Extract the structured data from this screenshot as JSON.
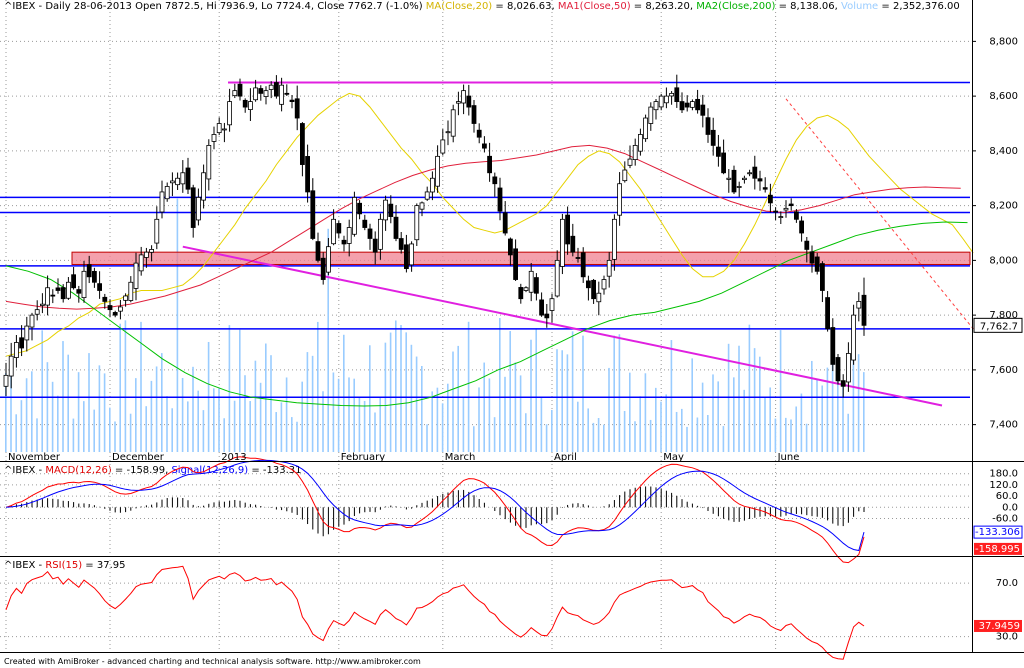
{
  "header": {
    "price": {
      "symbol": "^IBEX",
      "info": " - Daily 28-06-2013 Open 7872.5, Hi 7936.9, Lo 7724.4, Close 7762.7 (-1.0%) ",
      "ma20_label": "MA(Close,20)",
      "ma20_value": " = 8,026.63, ",
      "ma50_label": "MA1(Close,50)",
      "ma50_value": " = 8,263.20, ",
      "ma200_label": "MA2(Close,200)",
      "ma200_value": " = 8,138.06, ",
      "vol_label": "Volume",
      "vol_value": " = 2,352,376.00"
    },
    "macd": {
      "symbol": "^IBEX",
      "sep": " - ",
      "macd_label": "MACD(12,26)",
      "macd_value": " = -158.99, ",
      "signal_label": "Signal(12,26,9)",
      "signal_value": " = -133.31"
    },
    "rsi": {
      "symbol": "^IBEX",
      "sep": " - ",
      "rsi_label": "RSI(15)",
      "rsi_value": " = 37.95"
    }
  },
  "footer": "Created with AmiBroker - advanced charting and technical analysis software. http://www.amibroker.com",
  "colors": {
    "up_bar": "#ffffff",
    "down_bar": "#000000",
    "ma20": "#e6d200",
    "ma50": "#e0203c",
    "ma200": "#00c000",
    "volume": "#99ccff",
    "support": "#0000ff",
    "trend": "#e020e0",
    "resistance_band": "#f08090",
    "macd": "#ff0000",
    "signal": "#0000ff",
    "rsi": "#ff0000"
  },
  "chart_data": [
    {
      "type": "candlestick",
      "title": "^IBEX - Daily 28-06-2013",
      "ohlc_last": {
        "open": 7872.5,
        "high": 7936.9,
        "low": 7724.4,
        "close": 7762.7,
        "change": "-1.0%"
      },
      "ylim": [
        7300,
        8900
      ],
      "yticks": [
        7400,
        7600,
        7800,
        8000,
        8200,
        8400,
        8600,
        8800
      ],
      "ytick_labels": [
        "7,400",
        "7,600",
        "7,800",
        "8,000",
        "8,200",
        "8,400",
        "8,600",
        "8,800"
      ],
      "x_months": [
        {
          "label": "November",
          "day": 0
        },
        {
          "label": "December",
          "day": 20
        },
        {
          "label": "2013",
          "day": 41
        },
        {
          "label": "February",
          "day": 64
        },
        {
          "label": "March",
          "day": 84
        },
        {
          "label": "April",
          "day": 105
        },
        {
          "label": "May",
          "day": 126
        },
        {
          "label": "June",
          "day": 148
        }
      ],
      "last_price_label": "7,762.7",
      "horizontal_lines": [
        8650,
        8230,
        8175,
        7980,
        7750,
        7500
      ],
      "resistance_band": [
        7985,
        8030
      ],
      "trendline": [
        {
          "day": 34,
          "value": 8050
        },
        {
          "day": 180,
          "value": 7470
        }
      ],
      "dashed_trendline": [
        {
          "day": 150,
          "value": 8590
        },
        {
          "day": 186,
          "value": 7750
        }
      ],
      "closes": [
        7580,
        7650,
        7700,
        7680,
        7760,
        7800,
        7820,
        7840,
        7900,
        7870,
        7890,
        7860,
        7920,
        7900,
        7880,
        7960,
        7940,
        7920,
        7890,
        7850,
        7820,
        7800,
        7830,
        7870,
        7920,
        7990,
        8020,
        8030,
        8040,
        8150,
        8250,
        8270,
        8290,
        8300,
        8320,
        8260,
        8120,
        8230,
        8320,
        8420,
        8460,
        8500,
        8480,
        8580,
        8620,
        8600,
        8560,
        8580,
        8630,
        8610,
        8620,
        8640,
        8600,
        8640,
        8610,
        8580,
        8520,
        8350,
        8250,
        8080,
        8000,
        7930,
        8050,
        8150,
        8100,
        8060,
        8120,
        8230,
        8170,
        8120,
        8080,
        8030,
        8150,
        8220,
        8160,
        8080,
        8040,
        7970,
        8060,
        8200,
        8210,
        8250,
        8300,
        8380,
        8440,
        8470,
        8550,
        8580,
        8620,
        8560,
        8500,
        8450,
        8410,
        8320,
        8280,
        8180,
        8100,
        8020,
        7930,
        7860,
        7900,
        7960,
        7880,
        7800,
        7790,
        7860,
        8000,
        8150,
        8060,
        8030,
        8010,
        7940,
        7900,
        7860,
        7880,
        7930,
        8000,
        8150,
        8280,
        8330,
        8370,
        8420,
        8460,
        8520,
        8560,
        8580,
        8600,
        8600,
        8610,
        8580,
        8550,
        8560,
        8580,
        8550,
        8530,
        8460,
        8420,
        8380,
        8320,
        8300,
        8250,
        8270,
        8300,
        8320,
        8300,
        8290,
        8260,
        8210,
        8180,
        8160,
        8190,
        8200,
        8150,
        8100,
        8040,
        7990,
        7960,
        7890,
        7750,
        7620,
        7560,
        7540,
        7660,
        7800,
        7850,
        7762.7
      ],
      "ma20": [
        7650,
        7660,
        7670,
        7690,
        7710,
        7740,
        7760,
        7790,
        7810,
        7840,
        7850,
        7860,
        7880,
        7890,
        7890,
        7890,
        7900,
        7910,
        7940,
        7980,
        8030,
        8080,
        8130,
        8190,
        8240,
        8290,
        8350,
        8400,
        8450,
        8490,
        8530,
        8560,
        8590,
        8610,
        8600,
        8560,
        8510,
        8460,
        8410,
        8370,
        8320,
        8280,
        8230,
        8190,
        8150,
        8120,
        8110,
        8100,
        8110,
        8130,
        8150,
        8170,
        8200,
        8250,
        8300,
        8350,
        8380,
        8400,
        8390,
        8360,
        8310,
        8260,
        8200,
        8140,
        8080,
        8020,
        7970,
        7940,
        7940,
        7960,
        8000,
        8060,
        8130,
        8210,
        8290,
        8370,
        8440,
        8490,
        8520,
        8530,
        8510,
        8480,
        8430,
        8380,
        8340,
        8300,
        8260,
        8230,
        8200,
        8170,
        8150,
        8130,
        8080,
        8026.63
      ],
      "ma50": [
        7850,
        7840,
        7830,
        7825,
        7822,
        7825,
        7830,
        7840,
        7855,
        7870,
        7890,
        7910,
        7940,
        7970,
        8000,
        8030,
        8070,
        8110,
        8150,
        8190,
        8225,
        8255,
        8285,
        8310,
        8330,
        8345,
        8355,
        8360,
        8365,
        8375,
        8385,
        8400,
        8415,
        8420,
        8410,
        8390,
        8360,
        8330,
        8300,
        8270,
        8240,
        8215,
        8195,
        8180,
        8175,
        8185,
        8200,
        8220,
        8240,
        8250,
        8260,
        8265,
        8268,
        8265,
        8263.2
      ],
      "ma200": [
        7980,
        7960,
        7930,
        7880,
        7820,
        7760,
        7700,
        7640,
        7590,
        7550,
        7520,
        7500,
        7490,
        7480,
        7475,
        7470,
        7468,
        7470,
        7480,
        7500,
        7530,
        7560,
        7600,
        7630,
        7670,
        7710,
        7750,
        7780,
        7800,
        7810,
        7830,
        7850,
        7880,
        7920,
        7960,
        8000,
        8030,
        8060,
        8090,
        8110,
        8125,
        8135,
        8140,
        8138.06
      ],
      "volume_last": 2352376.0
    },
    {
      "type": "line",
      "title": "MACD(12,26) / Signal(12,26,9)",
      "ylim": [
        -240,
        200
      ],
      "yticks": [
        180,
        120,
        60,
        0,
        -60
      ],
      "ytick_labels": [
        "180.0",
        "120.0",
        "60.0",
        "0.0",
        "-60.0"
      ],
      "series": [
        {
          "name": "MACD(12,26)",
          "last": -158.99,
          "last_label": "-158.995"
        },
        {
          "name": "Signal(12,26,9)",
          "last": -133.31,
          "last_label": "-133.306"
        }
      ]
    },
    {
      "type": "line",
      "title": "RSI(15)",
      "ylim": [
        20,
        85
      ],
      "yticks": [
        70,
        30
      ],
      "ytick_labels": [
        "70.0",
        "30.0"
      ],
      "series": [
        {
          "name": "RSI(15)",
          "last": 37.95,
          "last_label": "37.9459"
        }
      ]
    }
  ]
}
